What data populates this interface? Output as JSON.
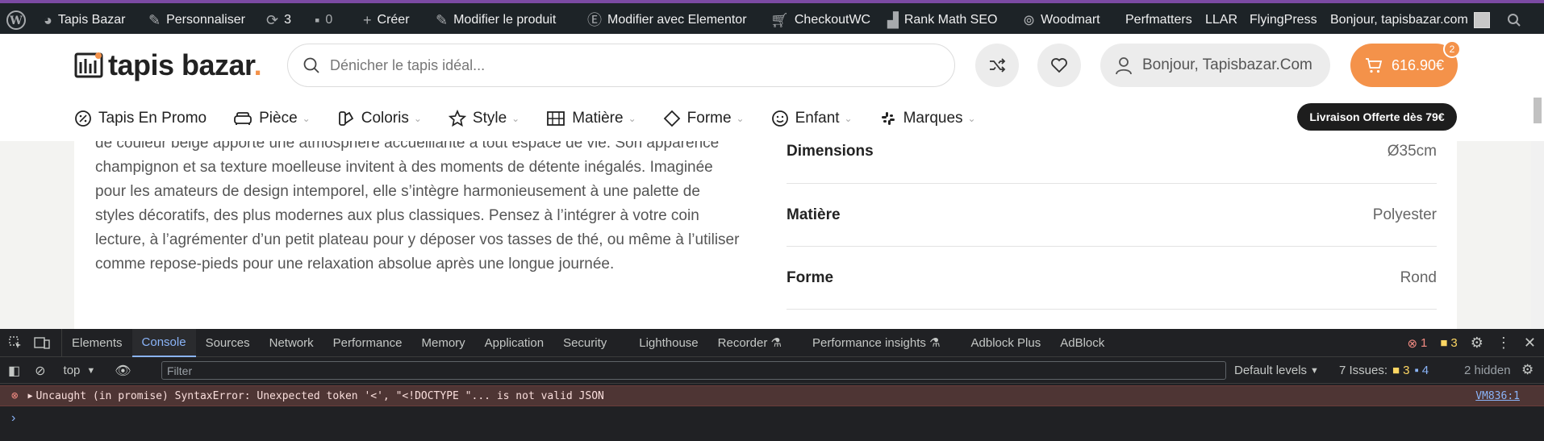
{
  "adminbar": {
    "site_name": "Tapis Bazar",
    "customize": "Personnaliser",
    "updates_count": "3",
    "comments_count": "0",
    "new": "Créer",
    "edit_product": "Modifier le produit",
    "elementor": "Modifier avec Elementor",
    "checkoutwc": "CheckoutWC",
    "rankmath": "Rank Math SEO",
    "woodmart": "Woodmart",
    "perfmatters": "Perfmatters",
    "llar": "LLAR",
    "flyingpress": "FlyingPress",
    "greeting": "Bonjour, tapisbazar.com"
  },
  "header": {
    "logo_text": "tapis bazar",
    "logo_dot": ".",
    "search_placeholder": "Dénicher le tapis idéal...",
    "user_label": "Bonjour, Tapisbazar.Com",
    "cart_total": "616.90€",
    "cart_count": "2",
    "promo_pill": "Livraison Offerte dès 79€",
    "accent_color": "#f4924a"
  },
  "nav": [
    {
      "label": "Tapis En Promo",
      "icon": "percent-icon",
      "dropdown": false
    },
    {
      "label": "Pièce",
      "icon": "sofa-icon",
      "dropdown": true
    },
    {
      "label": "Coloris",
      "icon": "swatch-icon",
      "dropdown": true
    },
    {
      "label": "Style",
      "icon": "star-icon",
      "dropdown": true
    },
    {
      "label": "Matière",
      "icon": "texture-icon",
      "dropdown": true
    },
    {
      "label": "Forme",
      "icon": "diamond-icon",
      "dropdown": true
    },
    {
      "label": "Enfant",
      "icon": "smile-icon",
      "dropdown": true
    },
    {
      "label": "Marques",
      "icon": "grid-icon",
      "dropdown": true
    }
  ],
  "description": "de couleur beige apporte une atmosphère accueillante à tout espace de vie. Son apparence champignon et sa texture moelleuse invitent à des moments de détente inégalés. Imaginée pour les amateurs de design intemporel, elle s’intègre harmonieusement à une palette de styles décoratifs, des plus modernes aux plus classiques. Pensez à l’intégrer à votre coin lecture, à l’agrémenter d’un petit plateau pour y déposer vos tasses de thé, ou même à l’utiliser comme repose-pieds pour une relaxation absolue après une longue journée.",
  "specs": [
    {
      "label": "Dimensions",
      "value": "Ø35cm"
    },
    {
      "label": "Matière",
      "value": "Polyester"
    },
    {
      "label": "Forme",
      "value": "Rond"
    }
  ],
  "devtools": {
    "tabs": [
      "Elements",
      "Console",
      "Sources",
      "Network",
      "Performance",
      "Memory",
      "Application",
      "Security",
      "Lighthouse",
      "Recorder",
      "Performance insights",
      "Adblock Plus",
      "AdBlock"
    ],
    "active_tab": "Console",
    "error_count": "1",
    "warning_count": "3",
    "context": "top",
    "filter_placeholder": "Filter",
    "levels": "Default levels",
    "issues_label": "7 Issues:",
    "issues_warn": "3",
    "issues_info": "4",
    "hidden": "2 hidden",
    "error_message": "Uncaught (in promise) SyntaxError: Unexpected token '<', \"<!DOCTYPE \"... is not valid JSON",
    "error_source": "VM836:1"
  }
}
